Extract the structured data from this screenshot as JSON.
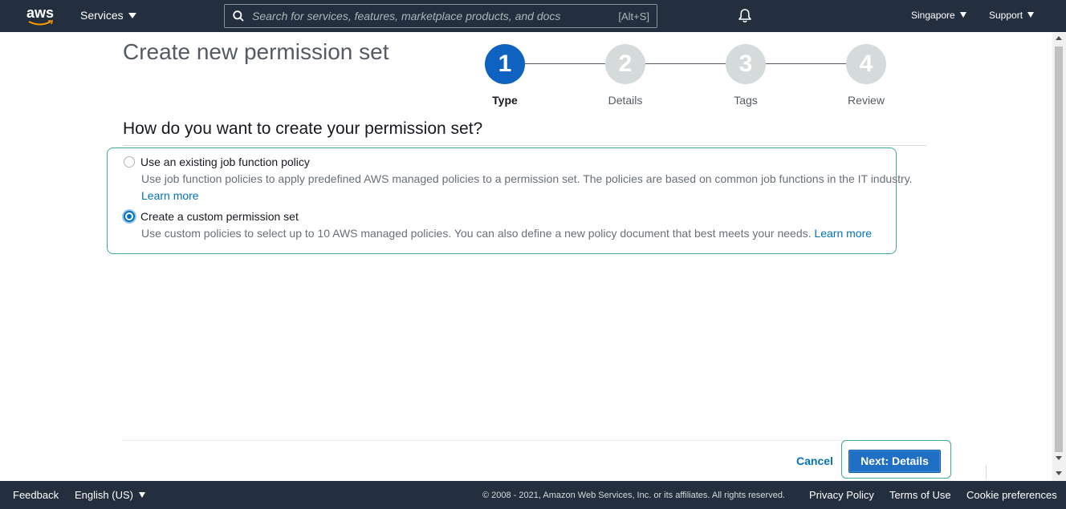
{
  "nav": {
    "logo_text": "aws",
    "services_label": "Services",
    "search_placeholder": "Search for services, features, marketplace products, and docs",
    "search_shortcut": "[Alt+S]",
    "region_label": "Singapore",
    "support_label": "Support"
  },
  "page": {
    "title": "Create new permission set",
    "question": "How do you want to create your permission set?"
  },
  "steps": [
    {
      "number": "1",
      "label": "Type",
      "active": true
    },
    {
      "number": "2",
      "label": "Details",
      "active": false
    },
    {
      "number": "3",
      "label": "Tags",
      "active": false
    },
    {
      "number": "4",
      "label": "Review",
      "active": false
    }
  ],
  "options": [
    {
      "label": "Use an existing job function policy",
      "description": "Use job function policies to apply predefined AWS managed policies to a permission set. The policies are based on common job functions in the IT industry.",
      "link": "Learn more",
      "selected": false
    },
    {
      "label": "Create a custom permission set",
      "description": "Use custom policies to select up to 10 AWS managed policies. You can also define a new policy document that best meets your needs.",
      "link": "Learn more",
      "selected": true
    }
  ],
  "actions": {
    "cancel_label": "Cancel",
    "next_label": "Next: Details"
  },
  "footer": {
    "feedback_label": "Feedback",
    "language_label": "English (US)",
    "copyright": "© 2008 - 2021, Amazon Web Services, Inc. or its affiliates. All rights reserved.",
    "privacy_label": "Privacy Policy",
    "terms_label": "Terms of Use",
    "cookies_label": "Cookie preferences"
  },
  "colors": {
    "nav_bg": "#232f3e",
    "accent": "#0073bb",
    "step_active": "#0f62bf",
    "step_inactive": "#d5dbdb",
    "focus_outline": "#3fa89a"
  }
}
